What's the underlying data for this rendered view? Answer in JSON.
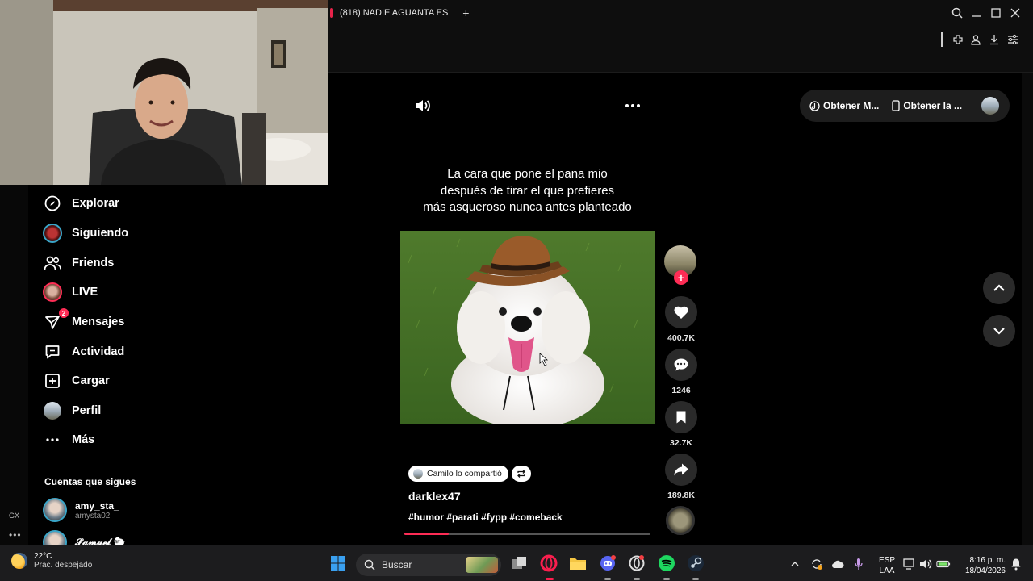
{
  "browser": {
    "tab_title": "(818) NADIE AGUANTA ES"
  },
  "sidebar": {
    "nav": [
      {
        "label": "Explorar"
      },
      {
        "label": "Siguiendo"
      },
      {
        "label": "Friends"
      },
      {
        "label": "LIVE"
      },
      {
        "label": "Mensajes",
        "badge": "2"
      },
      {
        "label": "Actividad"
      },
      {
        "label": "Cargar"
      },
      {
        "label": "Perfil"
      },
      {
        "label": "Más"
      }
    ],
    "following_title": "Cuentas que sigues",
    "following": [
      {
        "name": "amy_sta_",
        "handle": "amysta02"
      },
      {
        "name": "𝓢𝓪𝓶𝓾𝓮𝓵 🐑",
        "handle": ""
      }
    ]
  },
  "rail": {
    "gx_label": "GX"
  },
  "promo": {
    "item1": "Obtener M...",
    "item2": "Obtener la ..."
  },
  "post": {
    "caption_lines": [
      "La cara que pone el pana mio",
      "después de tirar el que prefieres",
      "más asqueroso nunca antes planteado"
    ],
    "shared_by": "Camilo lo compartió",
    "author": "darklex47",
    "hashtags": "#humor #parati #fypp #comeback",
    "progress": 0.18,
    "likes": "400.7K",
    "comments": "1246",
    "saves": "32.7K",
    "shares": "189.8K"
  },
  "taskbar": {
    "temp": "22°C",
    "weather": "Prac. despejado",
    "search_placeholder": "Buscar",
    "lang1": "ESP",
    "lang2": "LAA",
    "time": "8:16 p. m.",
    "date": "18/04/2026"
  },
  "colors": {
    "accent": "#fe2c55",
    "ring": "#3aa6c9",
    "panel": "#1d1d1d"
  }
}
